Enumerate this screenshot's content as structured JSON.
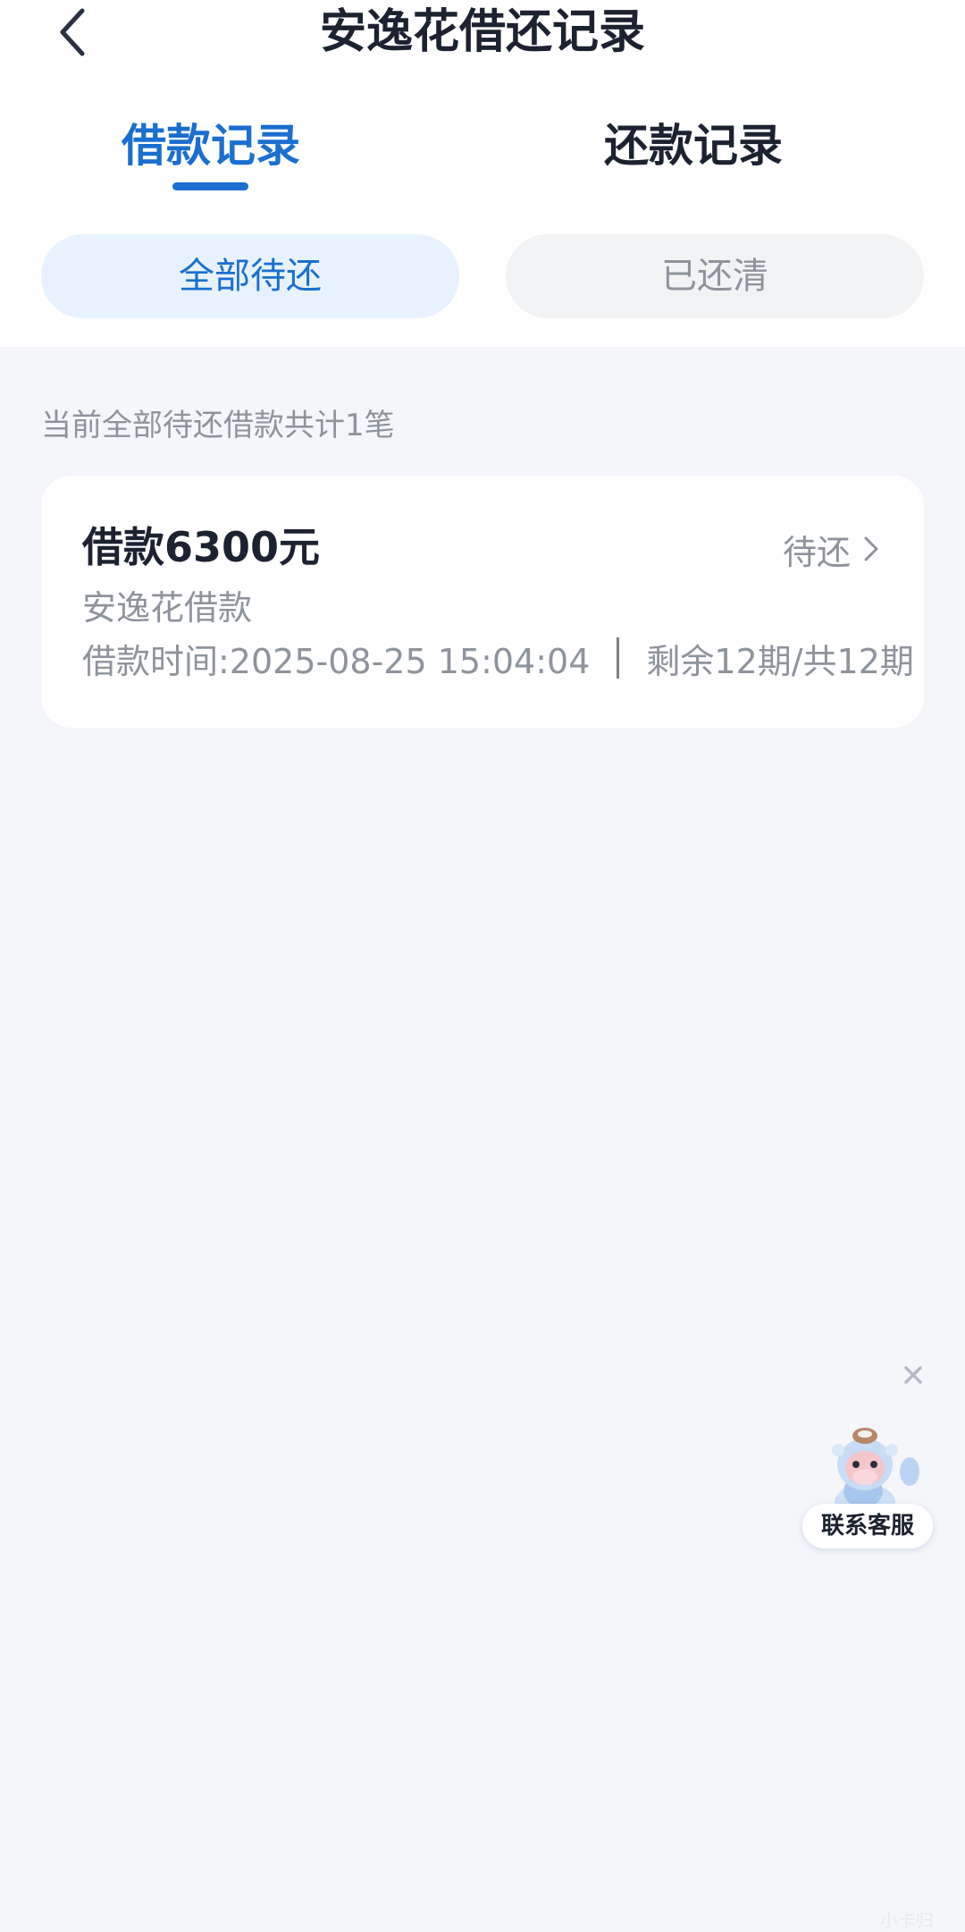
{
  "header": {
    "title": "安逸花借还记录"
  },
  "tabs": [
    {
      "label": "借款记录",
      "active": true
    },
    {
      "label": "还款记录",
      "active": false
    }
  ],
  "filters": [
    {
      "label": "全部待还",
      "active": true
    },
    {
      "label": "已还清",
      "active": false
    }
  ],
  "summary": "当前全部待还借款共计1笔",
  "loan": {
    "amount_label": "借款6300元",
    "status": "待还",
    "product": "安逸花借款",
    "borrow_time": "借款时间:2025-08-25 15:04:04",
    "periods": "剩余12期/共12期"
  },
  "support": {
    "label": "联系客服"
  },
  "watermark": "小卡归",
  "colors": {
    "accent": "#1a6fd0",
    "background": "#f4f6f9"
  }
}
